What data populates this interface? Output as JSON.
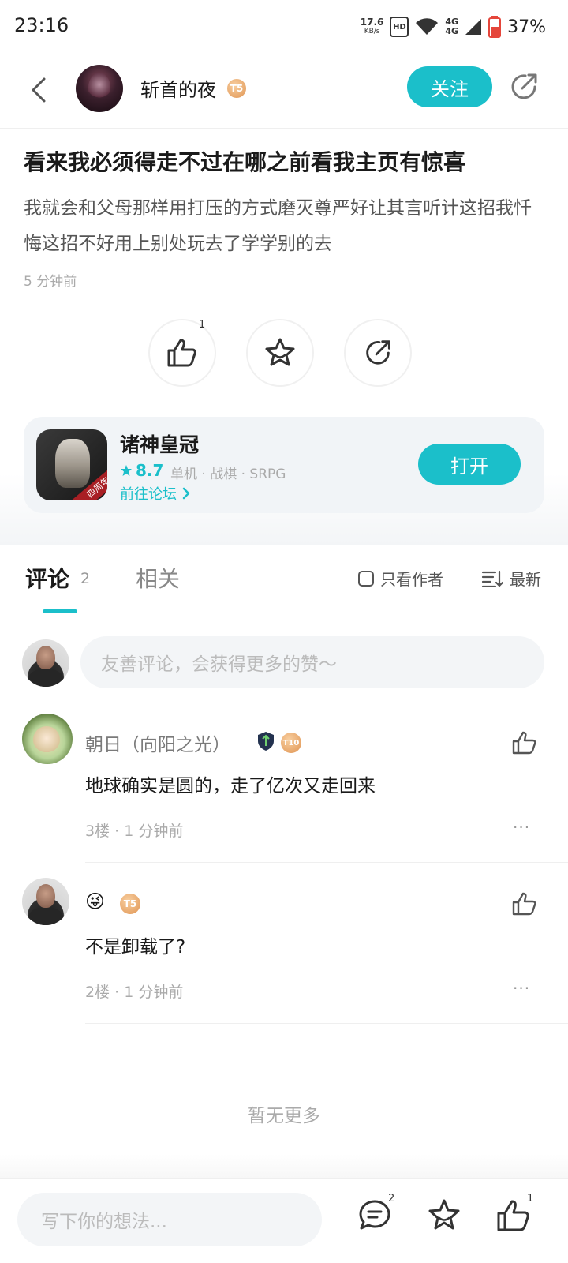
{
  "status_bar": {
    "time": "23:16",
    "net_speed": "17.6",
    "net_speed_unit": "KB/s",
    "hd_label": "HD",
    "network_4g_a": "4G",
    "network_4g_b": "4G",
    "battery": "37%"
  },
  "header": {
    "author_name": "斩首的夜",
    "author_level": "T5",
    "follow_label": "关注"
  },
  "post": {
    "title": "看来我必须得走不过在哪之前看我主页有惊喜",
    "body": "我就会和父母那样用打压的方式磨灭尊严好让其言听计这招我忏悔这招不好用上别处玩去了学学别的去",
    "time": "5 分钟前",
    "like_count": "1"
  },
  "game_card": {
    "name": "诸神皇冠",
    "rating": "8.7",
    "tags": "单机 · 战棋 · SRPG",
    "forum_link": "前往论坛",
    "open_label": "打开",
    "icon_ribbon": "四周年"
  },
  "tabs": {
    "comments_label": "评论",
    "comments_count": "2",
    "related_label": "相关",
    "only_author_label": "只看作者",
    "sort_label": "最新"
  },
  "comment_input": {
    "placeholder": "友善评论，会获得更多的赞～"
  },
  "comments": [
    {
      "user": "朝日（向阳之光）",
      "level": "T10",
      "text": "地球确实是圆的，走了亿次又走回来",
      "floor": "3楼 · 1 分钟前",
      "more": "···"
    },
    {
      "user_emoji": "😜",
      "level": "T5",
      "text": "不是卸载了?",
      "floor": "2楼 · 1 分钟前",
      "more": "···"
    }
  ],
  "no_more_text": "暂无更多",
  "bottom_bar": {
    "placeholder": "写下你的想法...",
    "comment_count": "2",
    "like_count": "1"
  },
  "colors": {
    "accent": "#1bbfca",
    "text_primary": "#1a1a1a",
    "text_muted": "#aaaaaa",
    "badge_orange": "#e7a66a"
  }
}
